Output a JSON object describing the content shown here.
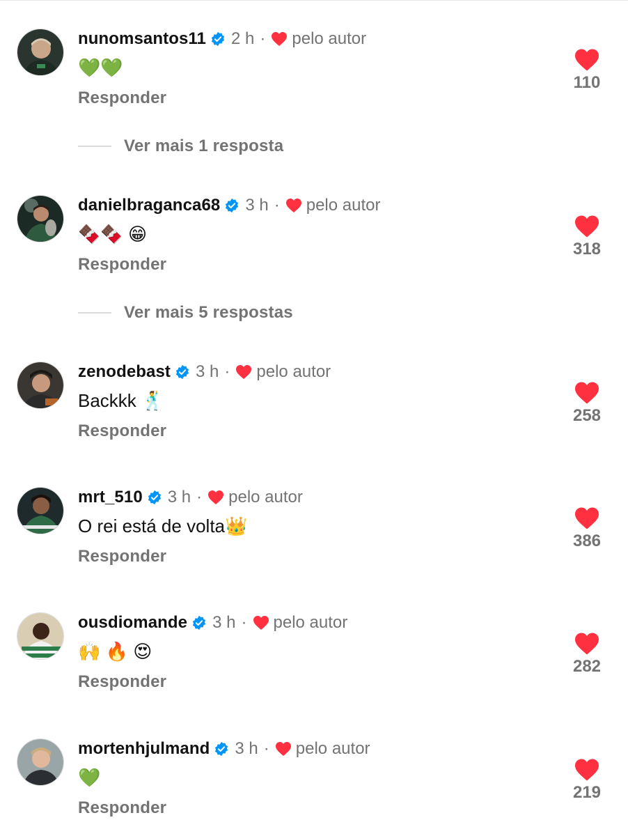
{
  "comments": [
    {
      "username": "nunomsantos11",
      "time": "2 h",
      "by_author": "pelo autor",
      "text": "💚💚",
      "reply": "Responder",
      "likes": "110",
      "view_replies": "Ver mais 1 resposta"
    },
    {
      "username": "danielbraganca68",
      "time": "3 h",
      "by_author": "pelo autor",
      "text": "🍫🍫 😁",
      "reply": "Responder",
      "likes": "318",
      "view_replies": "Ver mais 5 respostas"
    },
    {
      "username": "zenodebast",
      "time": "3 h",
      "by_author": "pelo autor",
      "text": "Backkk 🕺",
      "reply": "Responder",
      "likes": "258"
    },
    {
      "username": "mrt_510",
      "time": "3 h",
      "by_author": "pelo autor",
      "text": "O rei está de volta👑",
      "reply": "Responder",
      "likes": "386"
    },
    {
      "username": "ousdiomande",
      "time": "3 h",
      "by_author": "pelo autor",
      "text": "🙌 🔥 😍",
      "reply": "Responder",
      "likes": "282"
    },
    {
      "username": "mortenhjulmand",
      "time": "3 h",
      "by_author": "pelo autor",
      "text": "💚",
      "reply": "Responder",
      "likes": "219"
    }
  ],
  "colors": {
    "heart": "#ff3040",
    "verified": "#0095f6",
    "secondary_text": "#737373",
    "primary_text": "#121212"
  },
  "icons": {
    "verified": "verified-badge-icon",
    "author_like": "heart-filled-icon",
    "like": "heart-filled-icon"
  }
}
